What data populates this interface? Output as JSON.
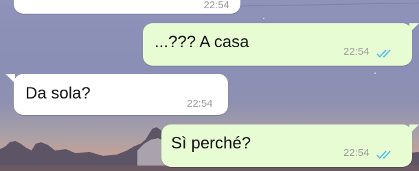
{
  "messages": [
    {
      "direction": "incoming",
      "text": "",
      "time": "22:54"
    },
    {
      "direction": "outgoing",
      "text": "...??? A casa",
      "time": "22:54",
      "status_icon": "double-check-icon"
    },
    {
      "direction": "incoming",
      "text": "Da sola?",
      "time": "22:54"
    },
    {
      "direction": "outgoing",
      "text": "Sì perché?",
      "time": "22:54",
      "status_icon": "double-check-icon"
    }
  ],
  "colors": {
    "incoming_bubble": "#ffffff",
    "outgoing_bubble": "#e7fcd3",
    "read_ticks": "#4fb6ec",
    "timestamp": "#9a9a9a"
  }
}
